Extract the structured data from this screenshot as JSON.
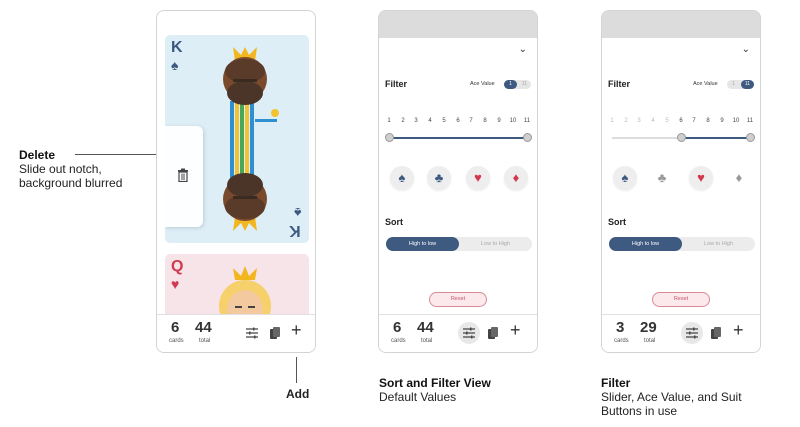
{
  "annotations": {
    "delete_title": "Delete",
    "delete_desc_1": "Slide out notch,",
    "delete_desc_2": "background blurred",
    "add_label": "Add"
  },
  "phone1": {
    "card1": {
      "rank": "K",
      "suit": "♠"
    },
    "card2": {
      "rank": "Q",
      "suit": "♥"
    },
    "count": "6",
    "count_label": "cards",
    "total": "44",
    "total_label": "total"
  },
  "phone2": {
    "filter_title": "Filter",
    "ace_label": "Ace Value",
    "ace_options": [
      "1",
      "11"
    ],
    "slider_numbers": [
      "1",
      "2",
      "3",
      "4",
      "5",
      "6",
      "7",
      "8",
      "9",
      "10",
      "11"
    ],
    "slider_range": [
      1,
      11
    ],
    "suits": [
      "♠",
      "♣",
      "♥",
      "♦"
    ],
    "sort_title": "Sort",
    "sort_options": [
      "High to low",
      "Low to High"
    ],
    "reset_label": "Reset",
    "count": "6",
    "count_label": "cards",
    "total": "44",
    "total_label": "total",
    "caption_title": "Sort and Filter View",
    "caption_desc": "Default Values"
  },
  "phone3": {
    "filter_title": "Filter",
    "ace_label": "Ace Value",
    "ace_options": [
      "1",
      "11"
    ],
    "slider_numbers": [
      "1",
      "2",
      "3",
      "4",
      "5",
      "6",
      "7",
      "8",
      "9",
      "10",
      "11"
    ],
    "slider_range": [
      6,
      11
    ],
    "suits": [
      "♠",
      "♣",
      "♥",
      "♦"
    ],
    "sort_title": "Sort",
    "sort_options": [
      "High to low",
      "Low to High"
    ],
    "reset_label": "Reset",
    "count": "3",
    "count_label": "cards",
    "total": "29",
    "total_label": "total",
    "caption_title": "Filter",
    "caption_desc_1": "Slider, Ace Value, and Suit",
    "caption_desc_2": "Buttons in use"
  },
  "colors": {
    "accent": "#3e5a80",
    "heart": "#d0394f",
    "spade": "#3e5a80"
  }
}
